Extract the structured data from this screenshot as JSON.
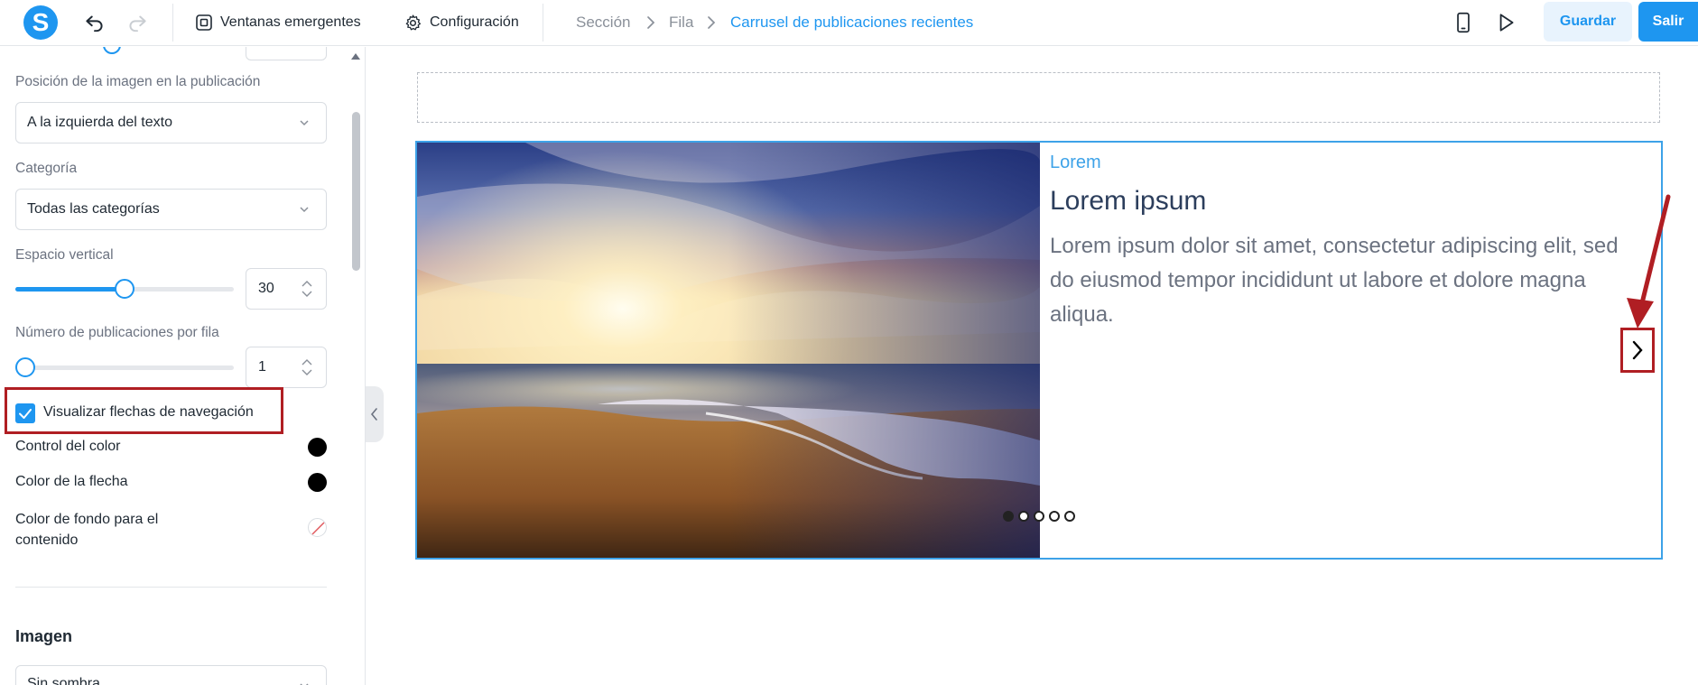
{
  "app": {
    "logo_letter": "S",
    "accent": "#1e96f0",
    "highlight": "#b01e23"
  },
  "toolbar": {
    "undo_icon": "undo-icon",
    "redo_icon": "redo-icon",
    "popups_label": "Ventanas emergentes",
    "settings_label": "Configuración",
    "save_label": "Guardar",
    "exit_label": "Salir"
  },
  "breadcrumb": {
    "items": [
      "Sección",
      "Fila",
      "Carrusel de publicaciones recientes"
    ]
  },
  "panel": {
    "image_position": {
      "label": "Posición de la imagen en la publicación",
      "value": "A la izquierda del texto"
    },
    "category": {
      "label": "Categoría",
      "value": "Todas las categorías"
    },
    "vertical_space": {
      "label": "Espacio vertical",
      "value": "30",
      "fraction": 0.5
    },
    "posts_per_row": {
      "label": "Número de publicaciones por fila",
      "value": "1",
      "fraction": 0.0
    },
    "show_arrows": {
      "label": "Visualizar flechas de navegación",
      "checked": true
    },
    "color_control": {
      "label": "Control del color",
      "color": "#000000"
    },
    "arrow_color": {
      "label": "Color de la flecha",
      "color": "#000000"
    },
    "content_bg": {
      "label": "Color de fondo para el contenido",
      "color": "none"
    },
    "image_section": {
      "title": "Imagen",
      "shadow_value": "Sin sombra"
    }
  },
  "post": {
    "category": "Lorem",
    "title": "Lorem ipsum",
    "excerpt": "Lorem ipsum dolor sit amet, consectetur adipiscing elit, sed do eiusmod tempor incididunt ut labore et dolore magna aliqua.",
    "image": "beach-sunset-image"
  },
  "pagination": {
    "total": 5,
    "active_index": 0
  }
}
